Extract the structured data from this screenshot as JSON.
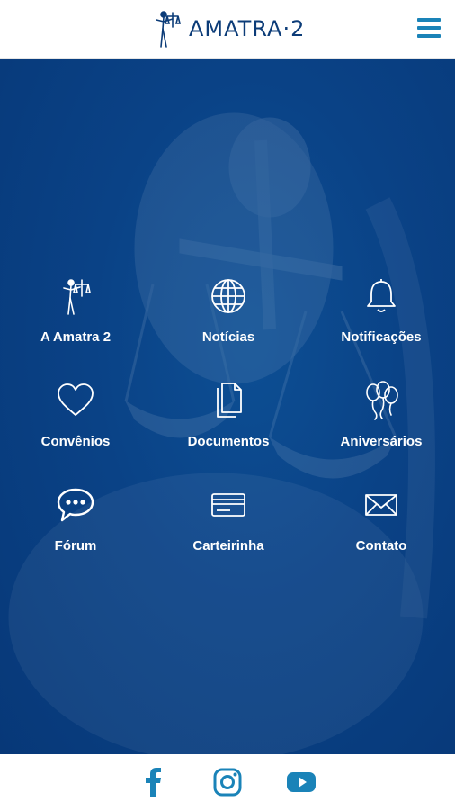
{
  "header": {
    "brand": "AMATRA·2",
    "logo_icon": "justice-figure-icon",
    "menu_icon": "hamburger-menu-icon"
  },
  "colors": {
    "brand_blue": "#0c3c78",
    "accent": "#1a83b8",
    "hero_bg": "#0a4286",
    "text_on_hero": "#ffffff"
  },
  "menu": {
    "items": [
      {
        "label": "A Amatra 2",
        "icon": "justice-figure-icon"
      },
      {
        "label": "Notícias",
        "icon": "globe-icon"
      },
      {
        "label": "Notificações",
        "icon": "bell-icon"
      },
      {
        "label": "Convênios",
        "icon": "heart-icon"
      },
      {
        "label": "Documentos",
        "icon": "documents-icon"
      },
      {
        "label": "Aniversários",
        "icon": "balloons-icon"
      },
      {
        "label": "Fórum",
        "icon": "chat-bubble-icon"
      },
      {
        "label": "Carteirinha",
        "icon": "card-icon"
      },
      {
        "label": "Contato",
        "icon": "envelope-icon"
      }
    ]
  },
  "footer": {
    "social": [
      {
        "name": "facebook",
        "icon": "facebook-icon"
      },
      {
        "name": "instagram",
        "icon": "instagram-icon"
      },
      {
        "name": "youtube",
        "icon": "youtube-icon"
      }
    ]
  }
}
